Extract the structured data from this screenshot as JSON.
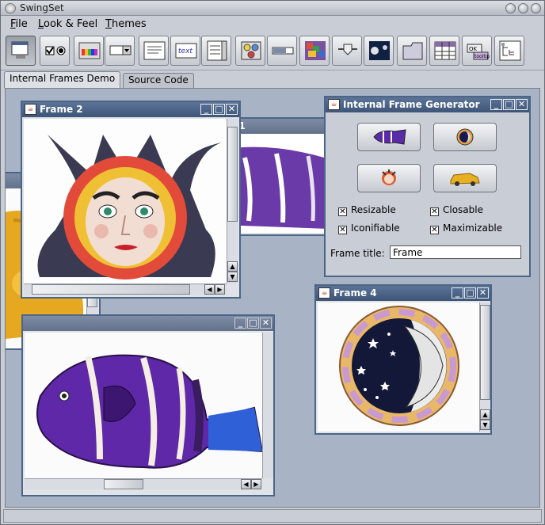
{
  "window": {
    "title": "SwingSet"
  },
  "menu": {
    "items": [
      {
        "label": "File",
        "mnemonic": "F"
      },
      {
        "label": "Look & Feel",
        "mnemonic": "L"
      },
      {
        "label": "Themes",
        "mnemonic": "T"
      }
    ]
  },
  "toolbar": {
    "buttons": [
      {
        "name": "internal-frames-icon",
        "selected": true
      },
      {
        "name": "checkbox-radio-icon"
      },
      {
        "name": "color-chooser-icon"
      },
      {
        "name": "combobox-icon"
      },
      {
        "name": "file-chooser-icon"
      },
      {
        "name": "editor-pane-icon"
      },
      {
        "name": "list-icon"
      },
      {
        "name": "option-pane-icon"
      },
      {
        "name": "progress-bar-icon"
      },
      {
        "name": "scroll-pane-icon"
      },
      {
        "name": "slider-icon"
      },
      {
        "name": "split-pane-icon"
      },
      {
        "name": "tabbed-pane-icon"
      },
      {
        "name": "table-icon"
      },
      {
        "name": "tooltip-icon"
      },
      {
        "name": "tree-icon"
      }
    ]
  },
  "tabs": [
    {
      "label": "Internal Frames Demo",
      "active": true
    },
    {
      "label": "Source Code",
      "active": false
    }
  ],
  "frames": {
    "frame2": {
      "title": "Frame 2"
    },
    "frame1": {
      "title": "Frame 1",
      "visible_fragment": "e 1"
    },
    "frame4": {
      "title": "Frame 4"
    }
  },
  "generator": {
    "title": "Internal Frame Generator",
    "buttons": [
      "fish-button-icon",
      "moon-button-icon",
      "sun-button-icon",
      "toy-car-button-icon"
    ],
    "options": [
      {
        "label": "Resizable",
        "checked": true
      },
      {
        "label": "Closable",
        "checked": true
      },
      {
        "label": "Iconifiable",
        "checked": true
      },
      {
        "label": "Maximizable",
        "checked": true
      }
    ],
    "frame_title_label": "Frame title:",
    "frame_title_value": "Frame"
  },
  "colors": {
    "desktop": "#a8b3c6",
    "active_title": "#4c6587",
    "inactive_title": "#6e7d96"
  }
}
